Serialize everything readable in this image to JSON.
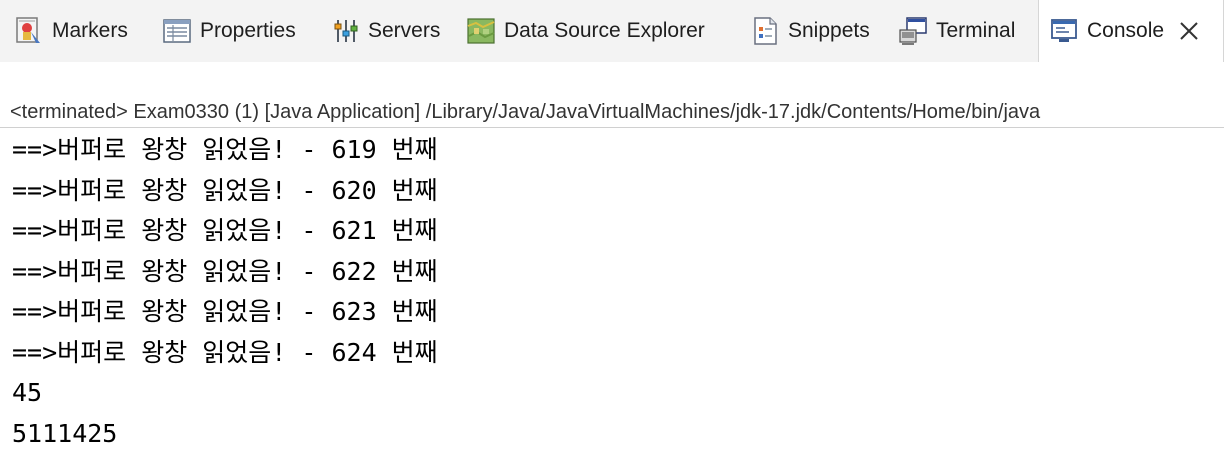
{
  "tabs": [
    {
      "label": "Markers",
      "icon": "markers-icon"
    },
    {
      "label": "Properties",
      "icon": "properties-icon"
    },
    {
      "label": "Servers",
      "icon": "servers-icon"
    },
    {
      "label": "Data Source Explorer",
      "icon": "data-source-explorer-icon"
    },
    {
      "label": "Snippets",
      "icon": "snippets-icon"
    },
    {
      "label": "Terminal",
      "icon": "terminal-icon"
    },
    {
      "label": "Console",
      "icon": "console-icon",
      "active": true
    }
  ],
  "console": {
    "status": "<terminated> Exam0330 (1) [Java Application] /Library/Java/JavaVirtualMachines/jdk-17.jdk/Contents/Home/bin/java",
    "lines": [
      "==>버퍼로 왕창 읽었음! - 619 번째",
      "==>버퍼로 왕창 읽었음! - 620 번째",
      "==>버퍼로 왕창 읽었음! - 621 번째",
      "==>버퍼로 왕창 읽었음! - 622 번째",
      "==>버퍼로 왕창 읽었음! - 623 번째",
      "==>버퍼로 왕창 읽었음! - 624 번째",
      "45",
      "5111425"
    ]
  },
  "colors": {
    "tabbar_bg": "#f3f3f3",
    "active_tab_bg": "#ffffff",
    "text": "#1e1e1e"
  }
}
